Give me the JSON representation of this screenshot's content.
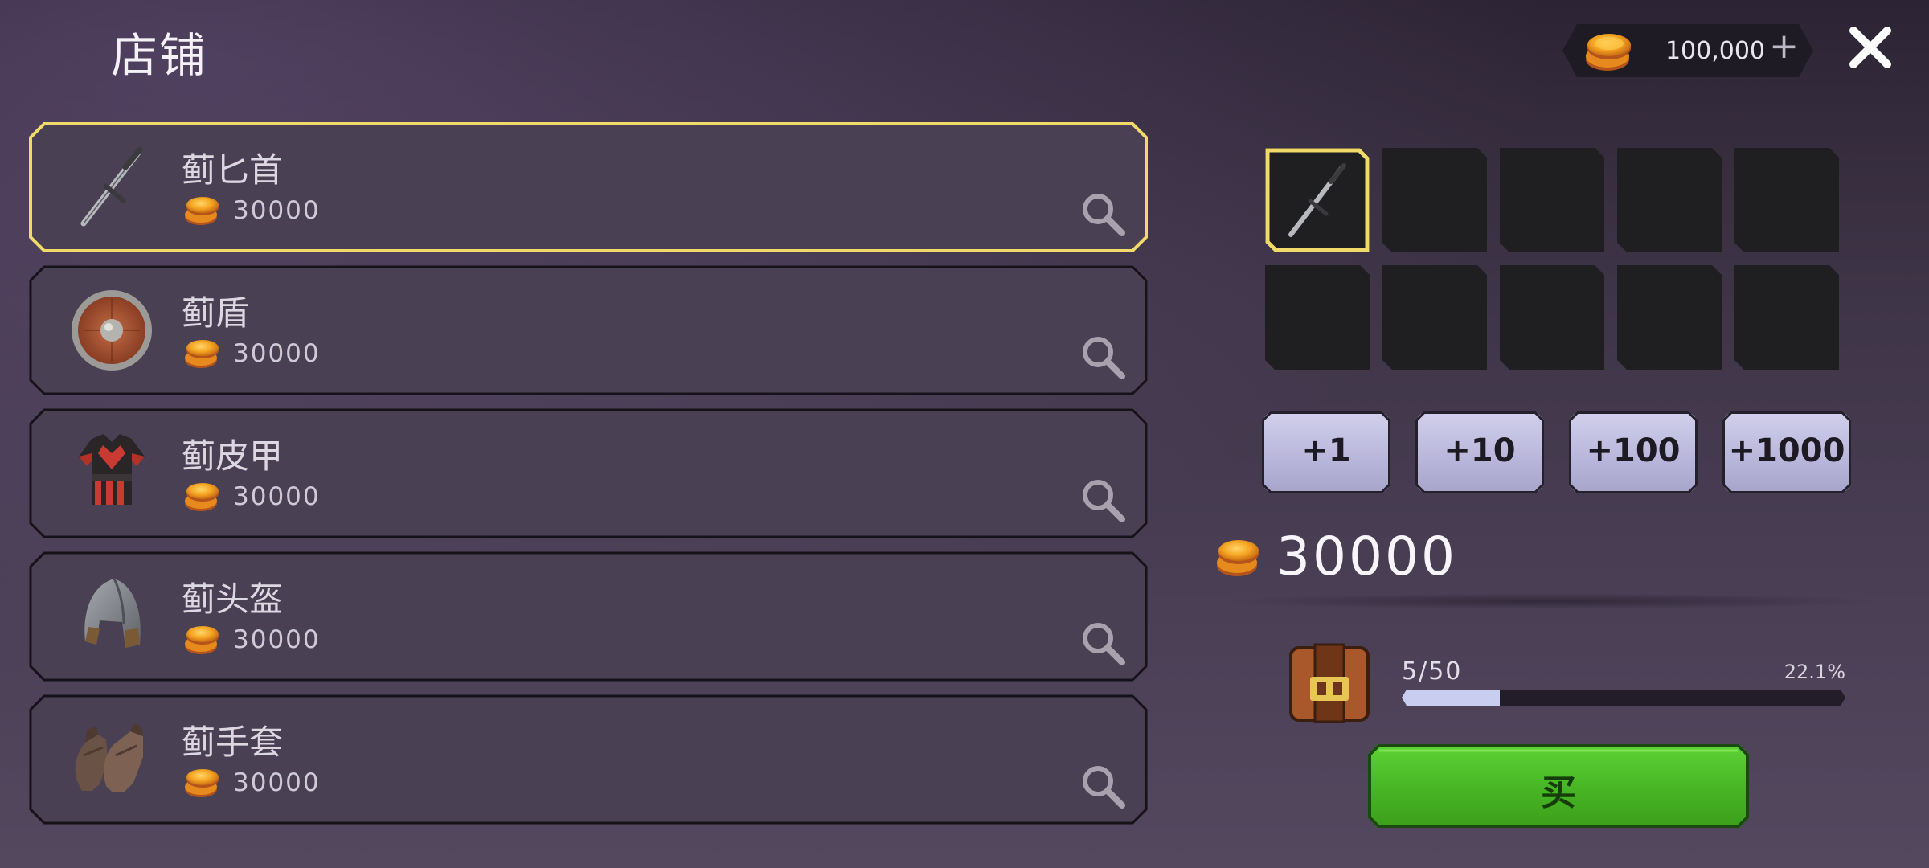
{
  "header": {
    "title": "店铺",
    "currency_amount": "100,000",
    "currency_plus": "+",
    "icons": {
      "currency": "gold-coin-icon",
      "add": "plus-icon",
      "close": "close-icon"
    }
  },
  "shop_items": [
    {
      "name": "蓟匕首",
      "price": "30000",
      "icon": "dagger-icon",
      "selected": true
    },
    {
      "name": "蓟盾",
      "price": "30000",
      "icon": "round-shield-icon",
      "selected": false
    },
    {
      "name": "蓟皮甲",
      "price": "30000",
      "icon": "leather-armor-icon",
      "selected": false
    },
    {
      "name": "蓟头盔",
      "price": "30000",
      "icon": "helmet-icon",
      "selected": false
    },
    {
      "name": "蓟手套",
      "price": "30000",
      "icon": "gloves-icon",
      "selected": false
    }
  ],
  "inventory": {
    "slot_count": 10,
    "filled_slots": [
      {
        "index": 0,
        "icon": "dagger-icon",
        "selected": true
      }
    ]
  },
  "quantity_buttons": [
    "+1",
    "+10",
    "+100",
    "+1000"
  ],
  "total_price": "30000",
  "bag_capacity": {
    "label": "5/50",
    "percent_label": "22.1%",
    "fill_fraction": 0.221,
    "icon": "backpack-icon"
  },
  "buy_button": {
    "label": "买"
  },
  "colors": {
    "selected_border": "#f1da6a",
    "item_background": "#4a4054",
    "slot_background": "#1f1e21",
    "buy_green": "#47b524",
    "quantity_button": "#b8b5da"
  }
}
